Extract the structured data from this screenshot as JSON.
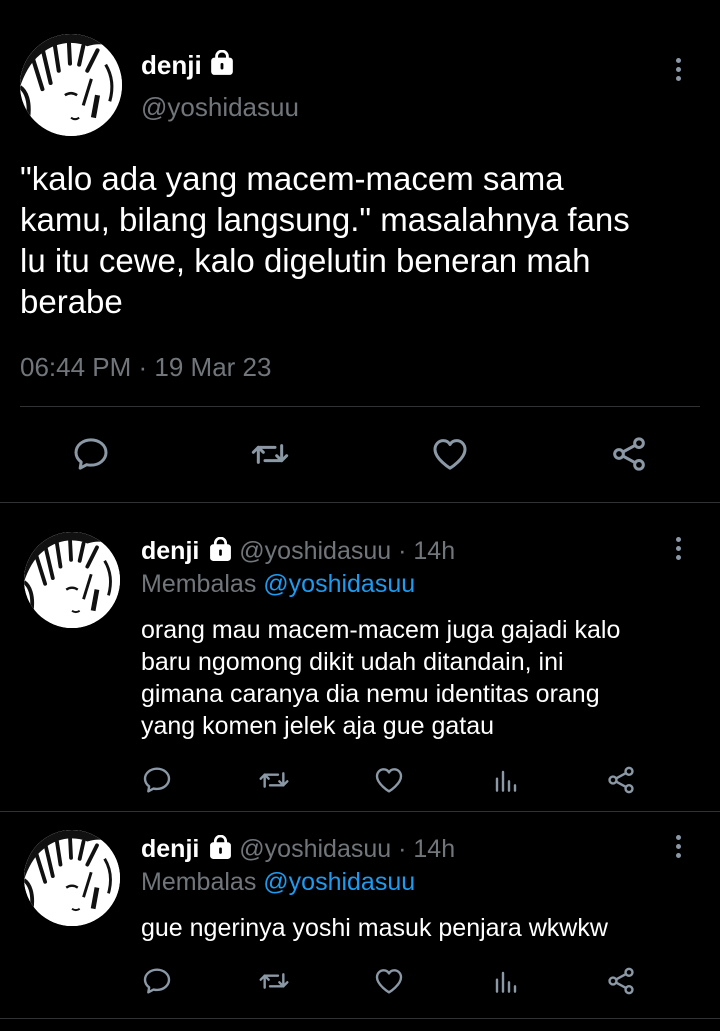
{
  "main_tweet": {
    "display_name": "denji",
    "handle": "@yoshidasuu",
    "text_lines": [
      "\"kalo ada yang macem-macem sama",
      "kamu, bilang langsung.\" masalahnya fans",
      "lu itu cewe, kalo digelutin beneran mah",
      "berabe"
    ],
    "timestamp": "06:44 PM · 19 Mar 23"
  },
  "replies": [
    {
      "display_name": "denji",
      "handle": "@yoshidasuu",
      "time": "· 14h",
      "replying_label": "Membalas",
      "replying_to": "@yoshidasuu",
      "text_lines": [
        "orang mau macem-macem juga gajadi kalo",
        "baru ngomong dikit udah ditandain, ini",
        "gimana caranya dia nemu identitas orang",
        "yang komen jelek aja gue gatau"
      ]
    },
    {
      "display_name": "denji",
      "handle": "@yoshidasuu",
      "time": "· 14h",
      "replying_label": "Membalas",
      "replying_to": "@yoshidasuu",
      "text_lines": [
        "gue ngerinya yoshi masuk penjara wkwkw"
      ]
    }
  ],
  "icons": {
    "more": "more-vertical-icon",
    "lock": "lock-icon",
    "reply": "reply-icon",
    "retweet": "retweet-icon",
    "like": "like-icon",
    "views": "views-icon",
    "share": "share-icon"
  },
  "colors": {
    "background": "#000000",
    "text": "#e7e9ea",
    "muted": "#71767b",
    "link": "#1d9bf0",
    "divider": "#2f3336"
  }
}
